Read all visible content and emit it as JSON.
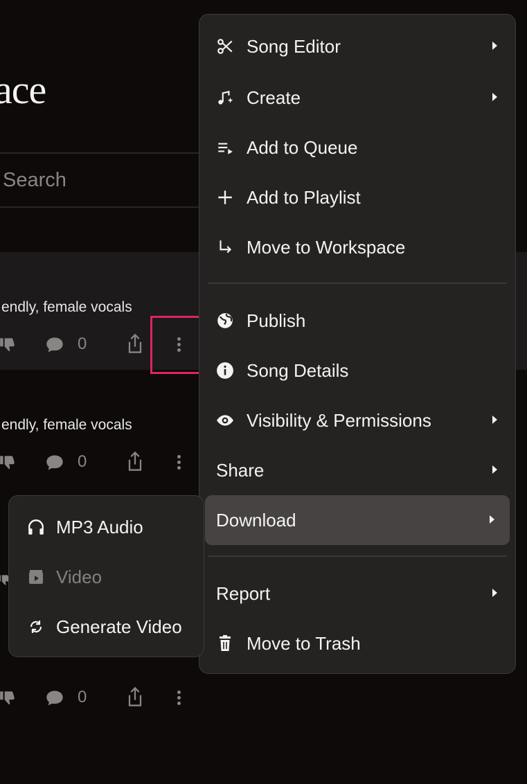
{
  "page": {
    "title": "ace",
    "search_placeholder": "Search"
  },
  "songs": [
    {
      "tags": "endly, female vocals",
      "comment_count": "0"
    },
    {
      "tags": "endly, female vocals",
      "comment_count": "0"
    },
    {
      "tags": "",
      "comment_count": "0"
    }
  ],
  "context_menu": {
    "items": [
      {
        "label": "Song Editor",
        "icon": "scissors-icon",
        "submenu": true
      },
      {
        "label": "Create",
        "icon": "music-sparkle-icon",
        "submenu": true
      },
      {
        "label": "Add to Queue",
        "icon": "queue-icon",
        "submenu": false
      },
      {
        "label": "Add to Playlist",
        "icon": "plus-icon",
        "submenu": false
      },
      {
        "label": "Move to Workspace",
        "icon": "arrow-down-right-icon",
        "submenu": false
      },
      {
        "label": "Publish",
        "icon": "globe-icon",
        "submenu": false
      },
      {
        "label": "Song Details",
        "icon": "info-icon",
        "submenu": false
      },
      {
        "label": "Visibility & Permissions",
        "icon": "eye-icon",
        "submenu": true
      },
      {
        "label": "Share",
        "icon": "",
        "submenu": true
      },
      {
        "label": "Download",
        "icon": "",
        "submenu": true,
        "active": true
      },
      {
        "label": "Report",
        "icon": "",
        "submenu": true
      },
      {
        "label": "Move to Trash",
        "icon": "trash-icon",
        "submenu": false
      }
    ]
  },
  "download_submenu": {
    "items": [
      {
        "label": "MP3 Audio",
        "icon": "headphones-icon",
        "disabled": false
      },
      {
        "label": "Video",
        "icon": "video-icon",
        "disabled": true
      },
      {
        "label": "Generate Video",
        "icon": "refresh-icon",
        "disabled": false
      }
    ]
  },
  "colors": {
    "background": "#0e0a0a",
    "menu_bg": "#252222",
    "active_item": "#474343",
    "highlight": "#e0245e"
  }
}
